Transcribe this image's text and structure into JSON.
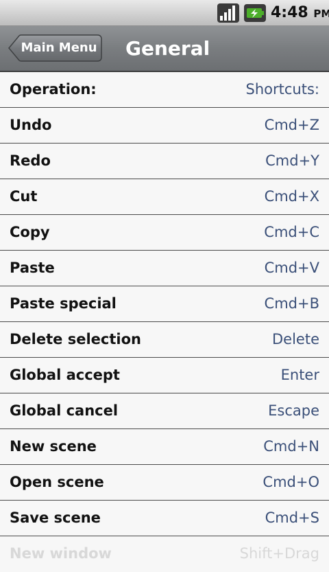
{
  "status_bar": {
    "time": "4:48",
    "ampm": "PM"
  },
  "nav": {
    "back_label": "Main Menu",
    "title": "General"
  },
  "header_row": {
    "operation": "Operation:",
    "shortcut": "Shortcuts:"
  },
  "rows": [
    {
      "operation": "Undo",
      "shortcut": "Cmd+Z"
    },
    {
      "operation": "Redo",
      "shortcut": "Cmd+Y"
    },
    {
      "operation": "Cut",
      "shortcut": "Cmd+X"
    },
    {
      "operation": "Copy",
      "shortcut": "Cmd+C"
    },
    {
      "operation": "Paste",
      "shortcut": "Cmd+V"
    },
    {
      "operation": "Paste special",
      "shortcut": "Cmd+B"
    },
    {
      "operation": "Delete selection",
      "shortcut": "Delete"
    },
    {
      "operation": "Global accept",
      "shortcut": "Enter"
    },
    {
      "operation": "Global cancel",
      "shortcut": "Escape"
    },
    {
      "operation": "New scene",
      "shortcut": "Cmd+N"
    },
    {
      "operation": "Open scene",
      "shortcut": "Cmd+O"
    },
    {
      "operation": "Save scene",
      "shortcut": "Cmd+S"
    }
  ],
  "partial_row": {
    "operation": "New window",
    "shortcut": "Shift+Drag"
  },
  "colors": {
    "shortcut_text": "#3a4f78",
    "battery_green": "#4caf2a",
    "nav_gradient_top": "#8f9295"
  },
  "icons": {
    "signal": "signal-strength-icon",
    "battery": "battery-charging-icon"
  }
}
